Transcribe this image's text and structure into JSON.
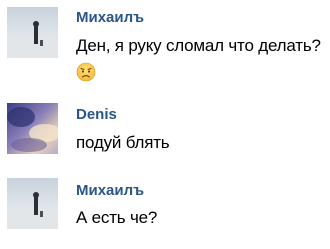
{
  "messages": [
    {
      "author": "Михаилъ",
      "text": "Ден, я руку сломал что делать?",
      "emoji": "worried-face-icon",
      "avatar": "avatar-mikhail"
    },
    {
      "author": "Denis",
      "text": "подуй блять",
      "avatar": "avatar-denis"
    },
    {
      "author": "Михаилъ",
      "text": "А есть че?",
      "avatar": "avatar-mikhail"
    }
  ],
  "colors": {
    "author_name": "#2b5788",
    "message_text": "#000000",
    "background": "#ffffff"
  }
}
